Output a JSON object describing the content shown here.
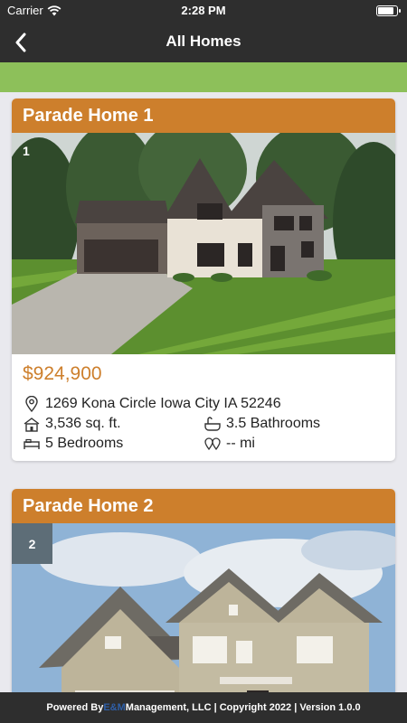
{
  "status_bar": {
    "carrier": "Carrier",
    "time": "2:28 PM"
  },
  "nav": {
    "title": "All Homes",
    "back_icon": "chevron-left-icon"
  },
  "homes": [
    {
      "title": "Parade Home 1",
      "number": "1",
      "price": "$924,900",
      "address": "1269 Kona Circle Iowa City IA 52246",
      "sqft": "3,536 sq. ft.",
      "bathrooms": "3.5 Bathrooms",
      "bedrooms": "5 Bedrooms",
      "distance": "-- mi"
    },
    {
      "title": "Parade Home 2",
      "number": "2"
    }
  ],
  "footer": {
    "prefix": "Powered By ",
    "brand": "E&M",
    "suffix": " Management, LLC | Copyright 2022 | Version 1.0.0"
  },
  "colors": {
    "accent": "#cd7f2c",
    "green_bar": "#8dc05a",
    "dark_bar": "#2e2e2e",
    "badge_bg": "#5d6d77"
  }
}
